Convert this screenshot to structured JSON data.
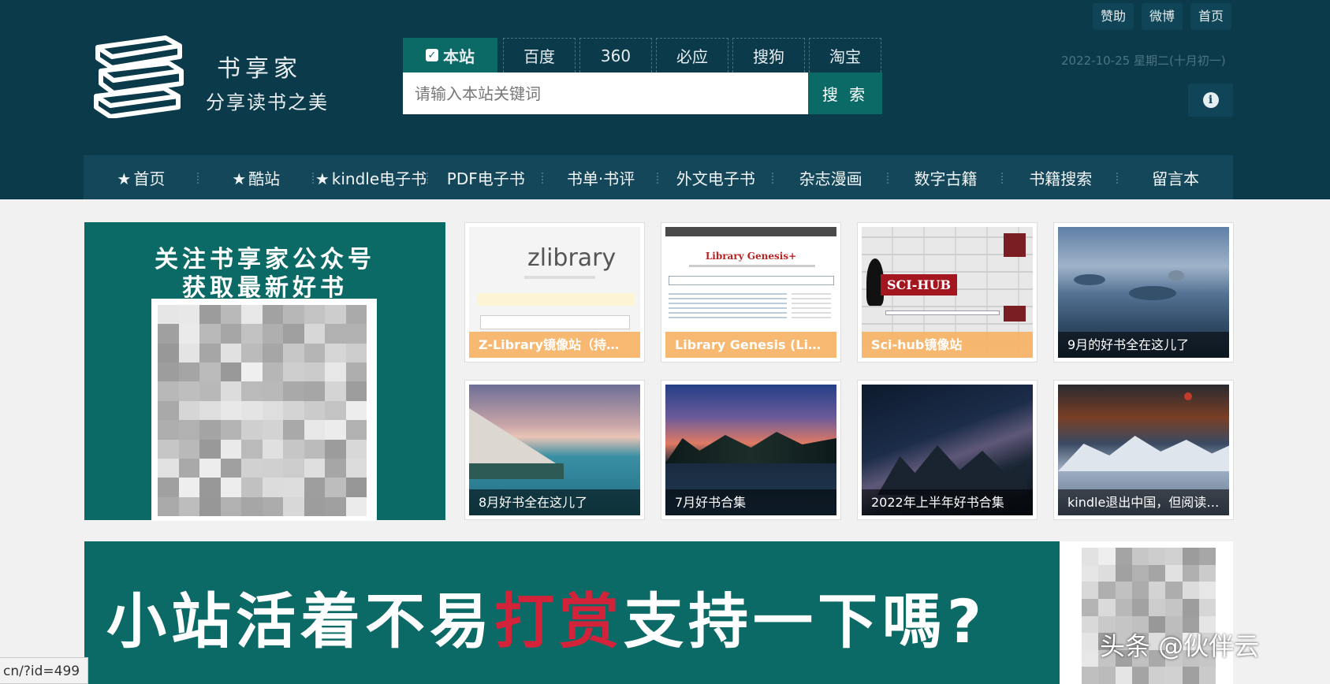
{
  "logo": {
    "name": "书享家",
    "slogan": "分享读书之美"
  },
  "top_links": [
    "赞助",
    "微博",
    "首页"
  ],
  "datetime": "2022-10-25 星期二(十月初一)",
  "info_icon": "info-icon",
  "search": {
    "tabs": [
      {
        "label": "本站",
        "active": true
      },
      {
        "label": "百度"
      },
      {
        "label": "360"
      },
      {
        "label": "必应"
      },
      {
        "label": "搜狗"
      },
      {
        "label": "淘宝"
      }
    ],
    "placeholder": "请输入本站关键词",
    "button": "搜 索"
  },
  "nav": [
    {
      "label": "首页",
      "icon": "star-icon"
    },
    {
      "label": "酷站",
      "icon": "star-icon"
    },
    {
      "label": "kindle电子书",
      "icon": "star-icon"
    },
    {
      "label": "PDF电子书"
    },
    {
      "label": "书单·书评"
    },
    {
      "label": "外文电子书"
    },
    {
      "label": "杂志漫画"
    },
    {
      "label": "数字古籍"
    },
    {
      "label": "书籍搜索"
    },
    {
      "label": "留言本"
    }
  ],
  "qr_panel": {
    "line1": "关注书享家公众号",
    "line2": "获取最新好书"
  },
  "cards": [
    {
      "caption": "Z-Library镜像站（持续更新）",
      "style": "orange"
    },
    {
      "caption": "Library Genesis (Libgen) 镜像",
      "style": "orange"
    },
    {
      "caption": "Sci-hub镜像站",
      "style": "orange"
    },
    {
      "caption": "9月的好书全在这儿了",
      "style": "dark"
    },
    {
      "caption": "8月好书全在这儿了",
      "style": "dark"
    },
    {
      "caption": "7月好书合集",
      "style": "dark"
    },
    {
      "caption": "2022年上半年好书合集",
      "style": "dark"
    },
    {
      "caption": "kindle退出中国，但阅读永不停止",
      "style": "dark"
    }
  ],
  "thumb_text": {
    "zlib": "zlibrary",
    "libgen": "Library Genesis+",
    "scihub": "SCI-HUB"
  },
  "banner": {
    "part1": "小站活着不易",
    "highlight": "打赏",
    "part2": "支持一下嗎?"
  },
  "url_status": "cn/?id=499",
  "watermark": "头条 @伙伴云",
  "colors": {
    "header": "#0b3a4a",
    "accent": "#0c6a66",
    "nav": "#15475a",
    "orange": "#f7b56a",
    "highlight": "#d3233a"
  }
}
